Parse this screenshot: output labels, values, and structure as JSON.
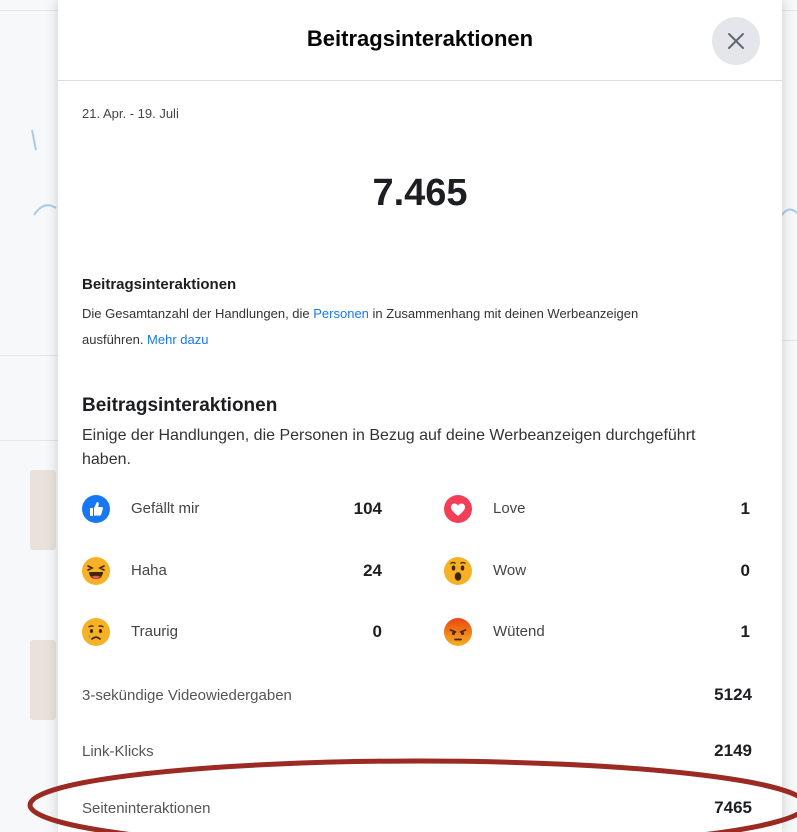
{
  "modal": {
    "title": "Beitragsinteraktionen",
    "date_range": "21. Apr. - 19. Juli",
    "total": "7.465"
  },
  "definition": {
    "title": "Beitragsinteraktionen",
    "text_part1": "Die Gesamtanzahl der Handlungen, die ",
    "link_people": "Personen",
    "text_part2": " in Zusammenhang mit deinen Werbeanzeigen ausführen. ",
    "link_more": "Mehr dazu"
  },
  "section": {
    "title": "Beitragsinteraktionen",
    "description": "Einige der Handlungen, die Personen in Bezug auf deine Werbeanzeigen durchgeführt haben."
  },
  "reactions": [
    {
      "label": "Gefällt mir",
      "count": "104",
      "icon": "like-icon",
      "color": "#1877f2"
    },
    {
      "label": "Love",
      "count": "1",
      "icon": "love-icon",
      "color": "#f33e58"
    },
    {
      "label": "Haha",
      "count": "24",
      "icon": "haha-icon",
      "color": "#f7b125"
    },
    {
      "label": "Wow",
      "count": "0",
      "icon": "wow-icon",
      "color": "#f7b125"
    },
    {
      "label": "Traurig",
      "count": "0",
      "icon": "sad-icon",
      "color": "#f7b125"
    },
    {
      "label": "Wütend",
      "count": "1",
      "icon": "angry-icon",
      "color": "#e9710f"
    }
  ],
  "stats": [
    {
      "label": "3-sekündige Videowiedergaben",
      "value": "5124"
    },
    {
      "label": "Link-Klicks",
      "value": "2149"
    },
    {
      "label": "Seiteninteraktionen",
      "value": "7465"
    }
  ],
  "colors": {
    "link": "#1877f2",
    "highlight": "#9b2a22"
  }
}
